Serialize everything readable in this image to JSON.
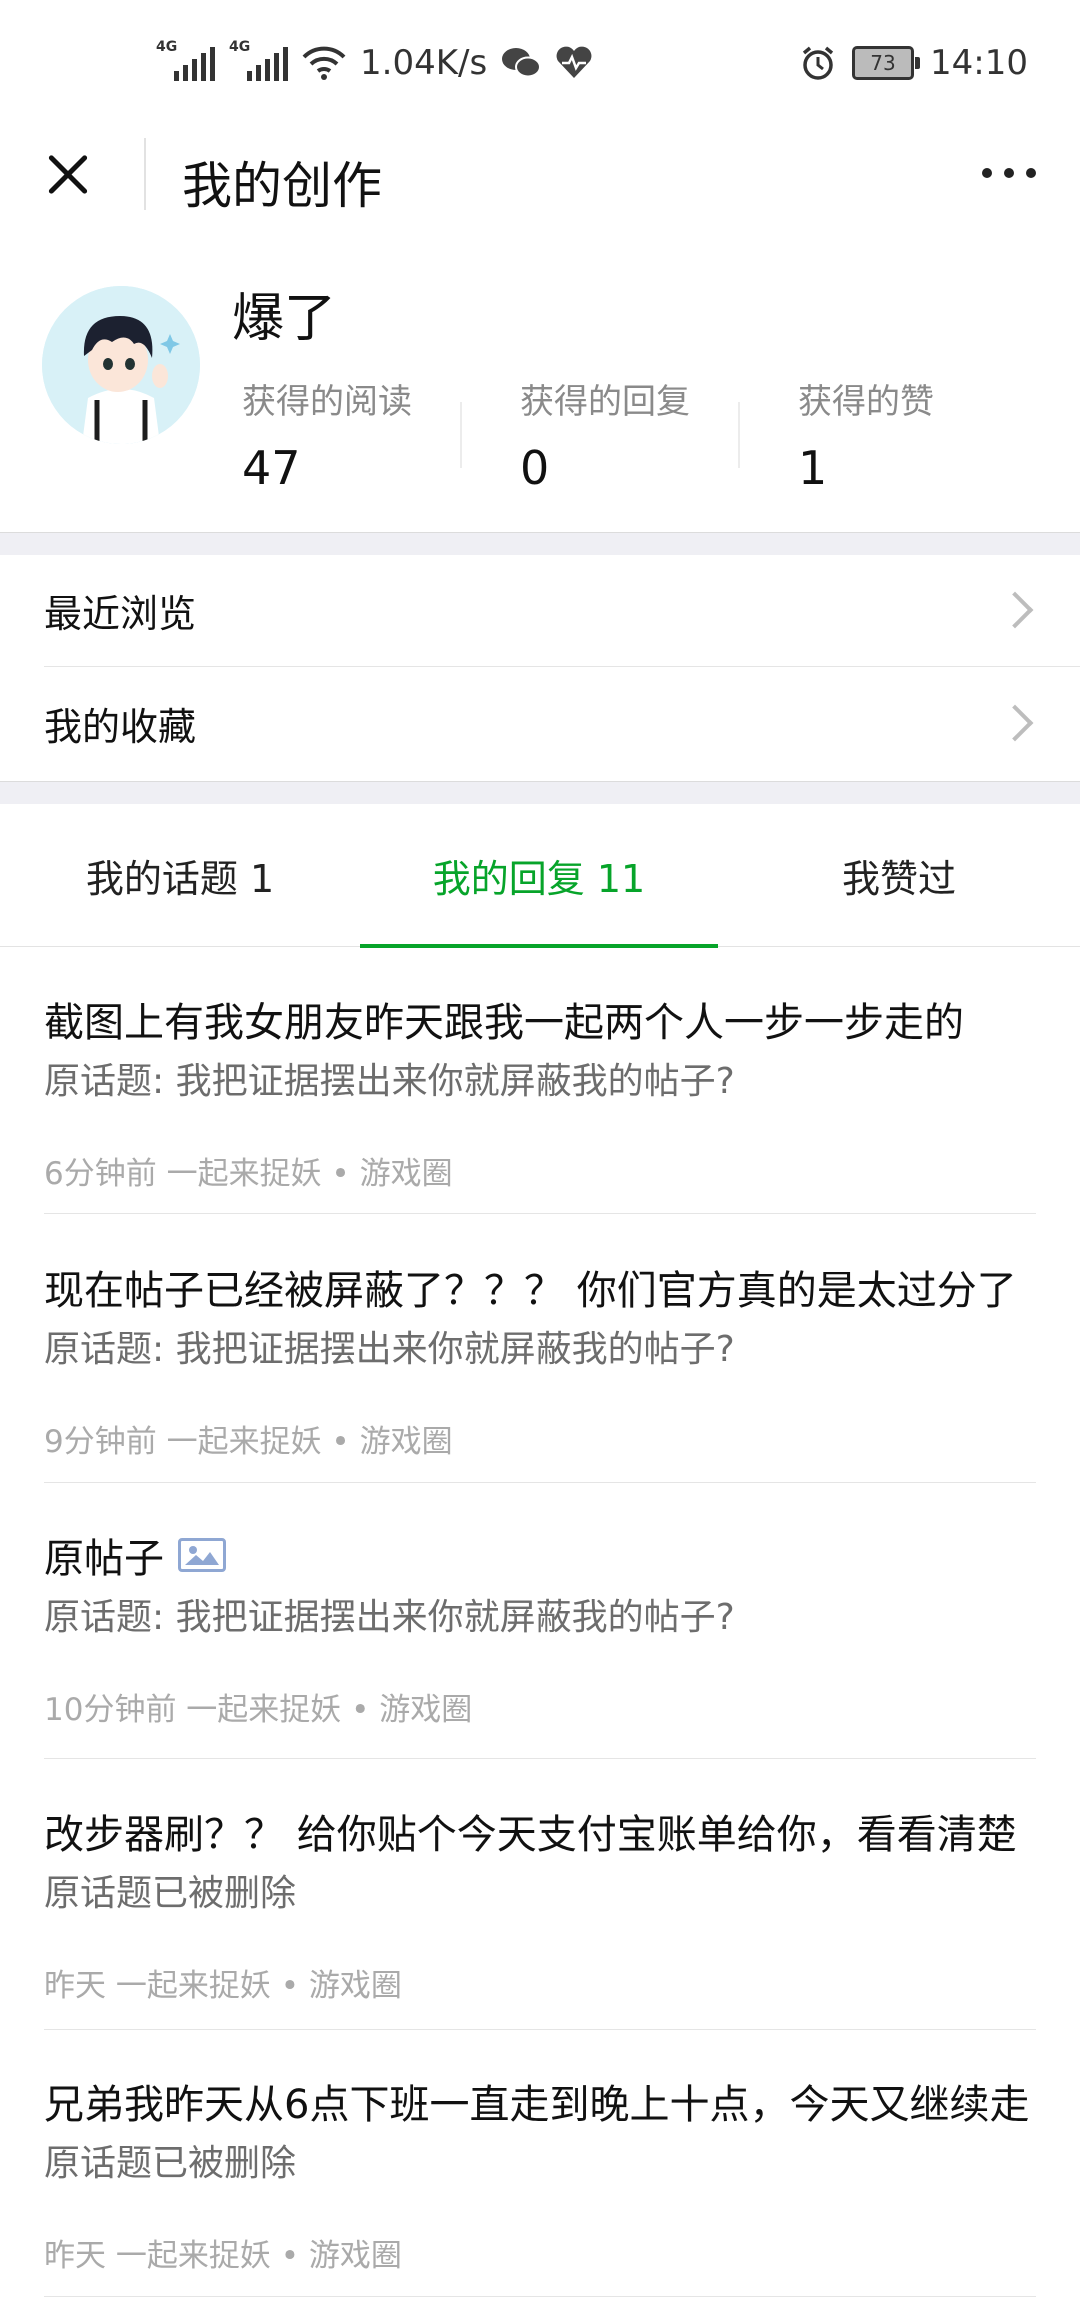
{
  "status_bar": {
    "net_label_1": "4G",
    "net_label_2": "4G",
    "speed": "1.04K/s",
    "battery": "73",
    "time": "14:10"
  },
  "header": {
    "title": "我的创作"
  },
  "profile": {
    "username": "爆了",
    "stats": [
      {
        "label": "获得的阅读",
        "value": "47"
      },
      {
        "label": "获得的回复",
        "value": "0"
      },
      {
        "label": "获得的赞",
        "value": "1"
      }
    ]
  },
  "menu": {
    "recent": "最近浏览",
    "favorites": "我的收藏"
  },
  "tabs": [
    {
      "label": "我的话题 1"
    },
    {
      "label": "我的回复 11"
    },
    {
      "label": "我赞过"
    }
  ],
  "active_tab_index": 1,
  "accent_color": "#07a42a",
  "replies": [
    {
      "title": "截图上有我女朋友昨天跟我一起两个人一步一步走的",
      "origin": "原话题: 我把证据摆出来你就屏蔽我的帖子?",
      "meta": "6分钟前 一起来捉妖 • 游戏圈"
    },
    {
      "title": "现在帖子已经被屏蔽了？？？ 你们官方真的是太过分了",
      "origin": "原话题: 我把证据摆出来你就屏蔽我的帖子?",
      "meta": "9分钟前 一起来捉妖 • 游戏圈"
    },
    {
      "title": "原帖子",
      "origin": "原话题: 我把证据摆出来你就屏蔽我的帖子?",
      "meta": "10分钟前 一起来捉妖 • 游戏圈",
      "has_image": true
    },
    {
      "title": "改步器刷？？ 给你贴个今天支付宝账单给你，看看清楚",
      "origin": "原话题已被删除",
      "meta": "昨天 一起来捉妖 • 游戏圈"
    },
    {
      "title": "兄弟我昨天从6点下班一直走到晚上十点，今天又继续走",
      "origin": "原话题已被删除",
      "meta": "昨天 一起来捉妖 • 游戏圈"
    }
  ]
}
